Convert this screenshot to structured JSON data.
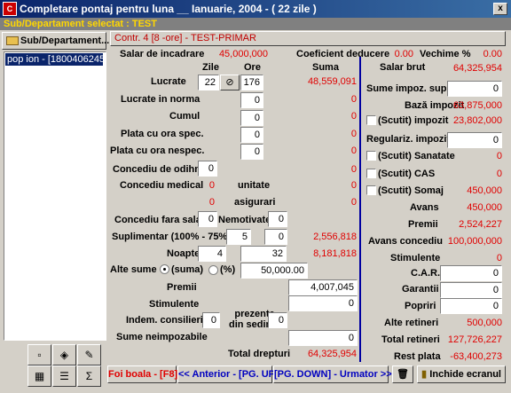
{
  "window": {
    "title": "Completare pontaj pentru luna __ Ianuarie, 2004 - ( 22 zile )",
    "close": "x",
    "subtitle": "Sub/Departament selectat : TEST"
  },
  "left": {
    "button": "Sub/Departament...",
    "list_item": "pop ion - [1800406245"
  },
  "contract": "Contr. 4 [8 -ore] - TEST-PRIMAR",
  "header": {
    "salar_label": "Salar de incadrare",
    "salar_value": "45,000,000",
    "coef_label": "Coeficient deducere",
    "coef_value": "0.00",
    "vechime_label": "Vechime %",
    "vechime_value": "0.00"
  },
  "cols": {
    "zile": "Zile",
    "ore": "Ore",
    "suma": "Suma",
    "salar_brut": "Salar brut"
  },
  "rows": {
    "lucrate": {
      "label": "Lucrate",
      "zile": "22",
      "ore": "176",
      "suma": "48,559,091"
    },
    "lucrate_norma": {
      "label": "Lucrate in norma",
      "ore": "0",
      "suma": "0"
    },
    "cumul": {
      "label": "Cumul",
      "ore": "0",
      "suma": "0"
    },
    "plata_spec": {
      "label": "Plata cu ora spec.",
      "ore": "0",
      "suma": "0"
    },
    "plata_nespec": {
      "label": "Plata cu ora nespec.",
      "ore": "0",
      "suma": "0"
    },
    "concediu_odihna": {
      "label": "Concediu de odihna",
      "zile": "0",
      "suma": "0"
    },
    "concediu_medical": {
      "label": "Concediu medical",
      "zile": "0",
      "unitate": "unitate",
      "suma1": "0",
      "zile2": "0",
      "asigurari": "asigurari",
      "suma2": "0"
    },
    "concediu_fara": {
      "label": "Concediu fara salar",
      "zile": "0",
      "nemotivate": "Nemotivate",
      "nem_val": "0"
    },
    "suplimentar": {
      "label": "Suplimentar (100% - 75%)",
      "v1": "5",
      "v2": "0",
      "suma": "2,556,818"
    },
    "noapte": {
      "label": "Noapte",
      "v1": "4",
      "v2": "32",
      "suma": "8,181,818"
    },
    "alte_sume": {
      "label": "Alte sume",
      "opt1": "(suma)",
      "opt2": "(%)",
      "value": "50,000.00"
    },
    "premii": {
      "label": "Premii",
      "value": "4,007,045"
    },
    "stimulente": {
      "label": "Stimulente",
      "value": "0"
    },
    "indem": {
      "label": "Indem. consilieri",
      "v": "0",
      "prezente": "prezente\ndin sedinte",
      "v2": "0"
    },
    "neimpozabile": {
      "label": "Sume neimpozabile",
      "value": "0"
    },
    "total_drepturi": {
      "label": "Total drepturi",
      "value": "64,325,954"
    }
  },
  "right": {
    "salar_brut": "64,325,954",
    "sume_impoz_label": "Sume impoz. supl.",
    "sume_impoz": "0",
    "baza_label": "Bază impozit",
    "baza": "63,875,000",
    "scutit_impozit_label": "(Scutit) impozit",
    "scutit_impozit": "23,802,000",
    "regulariz_label": "Regulariz. impozit",
    "regulariz": "0",
    "sanatate_label": "(Scutit) Sanatate",
    "sanatate": "0",
    "cas_label": "(Scutit) CAS",
    "cas": "0",
    "somaj_label": "(Scutit) Somaj",
    "somaj": "450,000",
    "avans_label": "Avans",
    "avans": "450,000",
    "premii_label": "Premii",
    "premii": "2,524,227",
    "avans_conc_label": "Avans concediu",
    "avans_conc": "100,000,000",
    "stimulente_label": "Stimulente",
    "stimulente": "0",
    "car_label": "C.A.R.",
    "car": "0",
    "garantii_label": "Garantii",
    "garantii": "0",
    "popriri_label": "Popriri",
    "popriri": "0",
    "alte_ret_label": "Alte retineri",
    "alte_ret": "500,000",
    "total_ret_label": "Total retineri",
    "total_ret": "127,726,227",
    "rest_label": "Rest plata",
    "rest": "-63,400,273"
  },
  "bottom": {
    "foi": "Foi boala - [F8]",
    "anterior": "<< Anterior - [PG. UP]",
    "urmator": "[PG. DOWN] - Urmator >>",
    "inchide": "Inchide ecranul"
  }
}
